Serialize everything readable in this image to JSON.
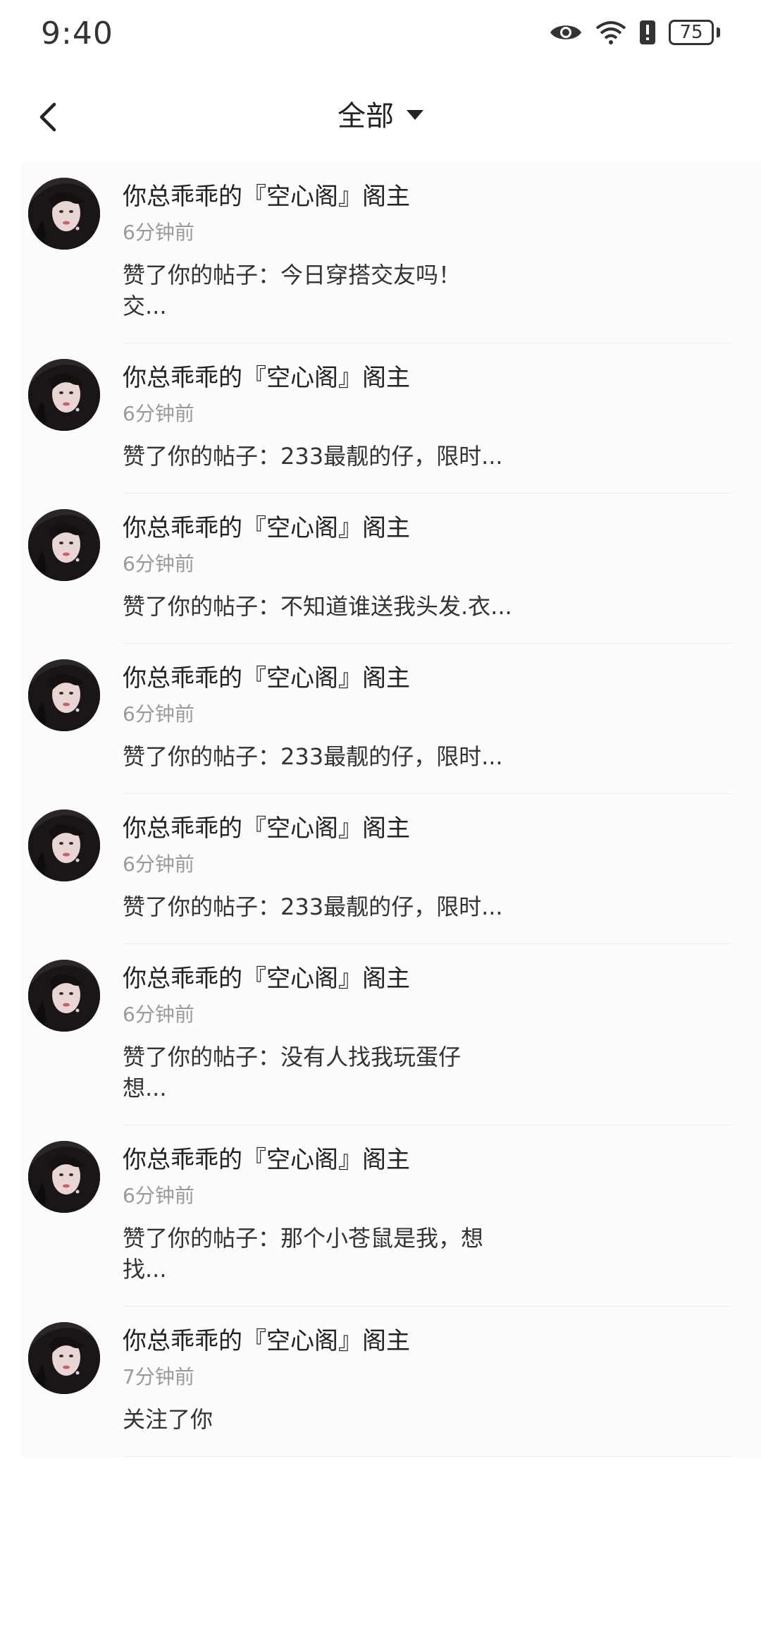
{
  "status_bar": {
    "time": "9:40",
    "battery": "75",
    "icons": [
      "eye-icon",
      "wifi-icon",
      "alert-icon",
      "battery-icon"
    ]
  },
  "header": {
    "title": "全部",
    "back_icon": "chevron-left-icon",
    "dropdown_icon": "caret-down-icon"
  },
  "notifications": [
    {
      "name": "你总乖乖的『空心阁』阁主",
      "time": "6分钟前",
      "text": "赞了你的帖子：今日穿搭交友吗！\n交..."
    },
    {
      "name": "你总乖乖的『空心阁』阁主",
      "time": "6分钟前",
      "text": "赞了你的帖子：233最靓的仔，限时..."
    },
    {
      "name": "你总乖乖的『空心阁』阁主",
      "time": "6分钟前",
      "text": "赞了你的帖子：不知道谁送我头发.衣..."
    },
    {
      "name": "你总乖乖的『空心阁』阁主",
      "time": "6分钟前",
      "text": "赞了你的帖子：233最靓的仔，限时..."
    },
    {
      "name": "你总乖乖的『空心阁』阁主",
      "time": "6分钟前",
      "text": "赞了你的帖子：233最靓的仔，限时..."
    },
    {
      "name": "你总乖乖的『空心阁』阁主",
      "time": "6分钟前",
      "text": "赞了你的帖子：没有人找我玩蛋仔\n想..."
    },
    {
      "name": "你总乖乖的『空心阁』阁主",
      "time": "6分钟前",
      "text": "赞了你的帖子：那个小苍鼠是我，想找..."
    },
    {
      "name": "你总乖乖的『空心阁』阁主",
      "time": "7分钟前",
      "text": "关注了你"
    }
  ]
}
